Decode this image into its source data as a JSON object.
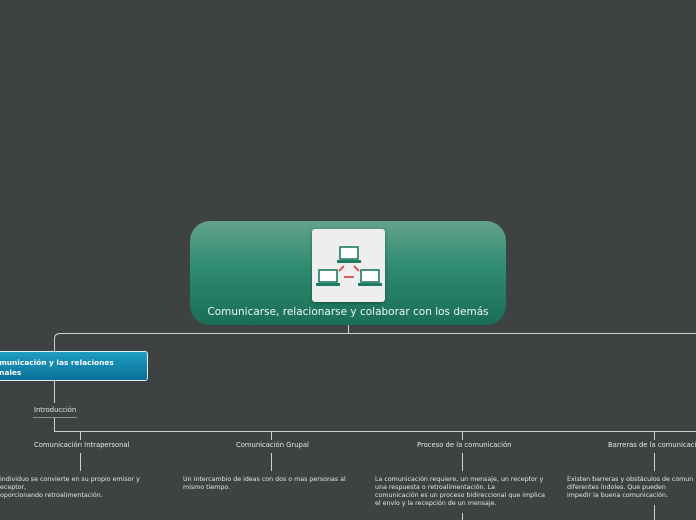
{
  "central": {
    "title": "Comunicarse, relacionarse y colaborar con los demás",
    "icon": "network-computers-icon"
  },
  "main_topic": {
    "label": "omunicación y las relaciones\nonales"
  },
  "subtopic": {
    "label": "Introducción"
  },
  "branches": [
    {
      "title": "Comunicación Intrapersonal",
      "text": "individuo se convierte en su propio emisor y\neceptor,\noporcionando retroalimentación."
    },
    {
      "title": "Comunicación Grupal",
      "text": "Un intercambio de ideas con dos o mas personas al\nmismo tiempo."
    },
    {
      "title": "Proceso de la comunicación",
      "text": "La comunicación requiere, un mensaje, un receptor y\nuna respuesta o retroalimentación. La\ncomunicación es un proceso bidireccional que implica\nel envío y la recepción de un mensaje."
    },
    {
      "title": "Barreras de la comunicación",
      "text": "Existen barreras y obstáculos de comun\ndiferentes índoles. Que pueden\nimpedir la buena comunicación."
    }
  ],
  "colors": {
    "background": "#3e4242",
    "central_fill": "#2f8b70",
    "topic_fill": "#1388b0",
    "line": "#d0d0d0"
  }
}
